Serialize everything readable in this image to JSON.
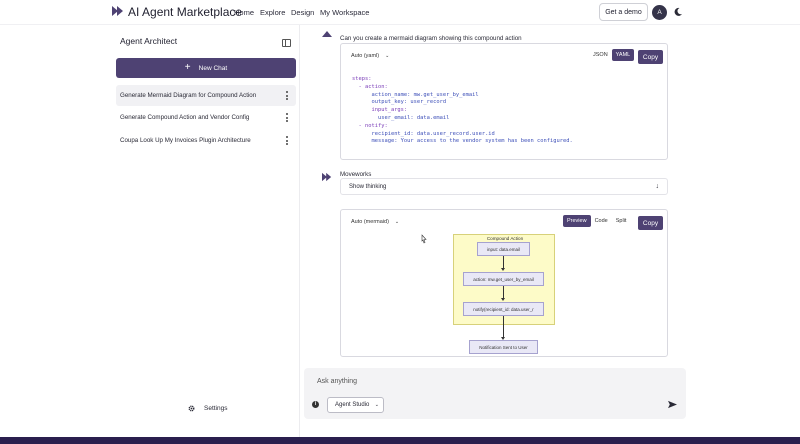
{
  "header": {
    "brand": "AI Agent Marketplace",
    "nav": [
      "Home",
      "Explore",
      "Design",
      "My Workspace"
    ],
    "demo_button": "Get a demo",
    "avatar_initial": "A"
  },
  "sidebar": {
    "title": "Agent Architect",
    "new_chat": "New Chat",
    "chats": [
      "Generate Mermaid Diagram for Compound Action",
      "Generate Compound Action and Vendor Config",
      "Coupa Look Up My Invoices Plugin Architecture"
    ],
    "settings": "Settings"
  },
  "conversation": {
    "user_prompt": "Can you create a mermaid diagram showing this compound action",
    "code_card": {
      "language_select": "Auto (yaml)",
      "formats": [
        "JSON",
        "YAML"
      ],
      "active_format": "YAML",
      "copy": "Copy",
      "code_lines": [
        "steps:",
        "  - action:",
        "      action_name: mw.get_user_by_email",
        "      output_key: user_record",
        "      input_args:",
        "        user_email: data.email",
        "  - notify:",
        "      recipient_id: data.user_record.user.id",
        "      message: Your access to the vendor system has been configured."
      ]
    },
    "bot_name": "Moveworks",
    "thinking_label": "Show thinking",
    "diagram_card": {
      "language_select": "Auto (mermaid)",
      "views": [
        "Preview",
        "Code",
        "Split"
      ],
      "active_view": "Preview",
      "copy": "Copy",
      "diagram": {
        "group_title": "Compound Action",
        "nodes": [
          "input: data.email",
          "action: mw.get_user_by_email",
          "notify(recipient_id: data.user_r",
          "Notification Sent to User"
        ]
      }
    }
  },
  "composer": {
    "placeholder": "Ask anything",
    "agent_select": "Agent Studio"
  },
  "colors": {
    "accent": "#4e4273",
    "footer": "#2a1f4e",
    "compound_fill": "#fdfbc8",
    "node_fill": "#e9e8f6"
  }
}
